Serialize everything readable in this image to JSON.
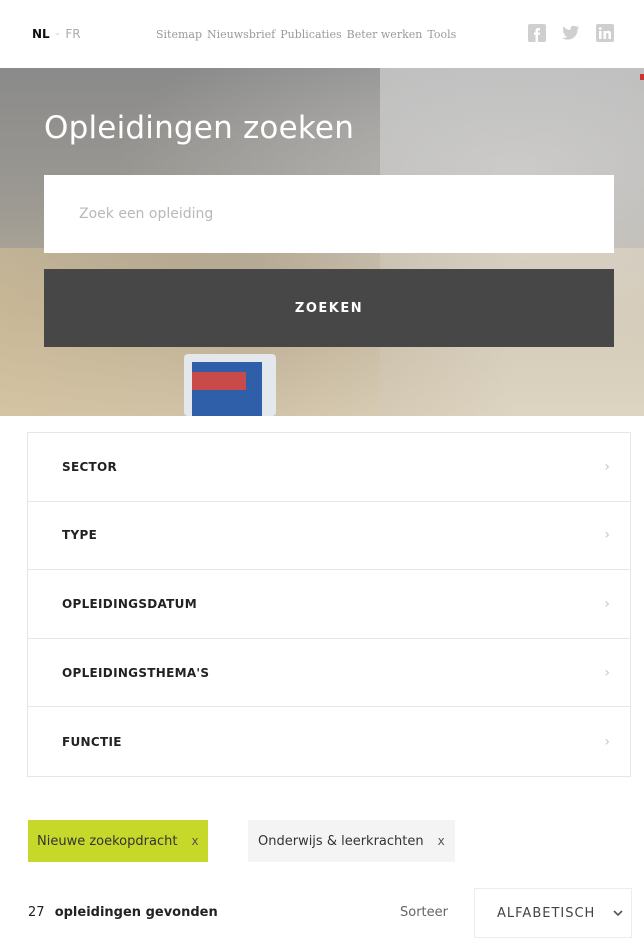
{
  "topbar": {
    "lang_active": "NL",
    "lang_separator": "-",
    "lang_other": "FR",
    "nav": [
      "Sitemap",
      "Nieuwsbrief",
      "Publicaties",
      "Beter werken",
      "Tools"
    ],
    "social_icons": [
      "facebook-icon",
      "twitter-icon",
      "linkedin-icon"
    ]
  },
  "hero": {
    "title": "Opleidingen zoeken",
    "search_placeholder": "Zoek een opleiding",
    "search_button": "ZOEKEN"
  },
  "filters": [
    {
      "label": "SECTOR"
    },
    {
      "label": "TYPE"
    },
    {
      "label": "OPLEIDINGSDATUM"
    },
    {
      "label": "OPLEIDINGSTHEMA'S"
    },
    {
      "label": "FUNCTIE"
    }
  ],
  "tags": {
    "new_search": "Nieuwe zoekopdracht",
    "active_filter": "Onderwijs & leerkrachten",
    "remove": "x"
  },
  "results": {
    "count": "27",
    "label": "opleidingen gevonden",
    "sort_label": "Sorteer",
    "sort_value": "ALFABETISCH"
  },
  "colors": {
    "accent": "#c6d92b",
    "button": "#474747"
  }
}
